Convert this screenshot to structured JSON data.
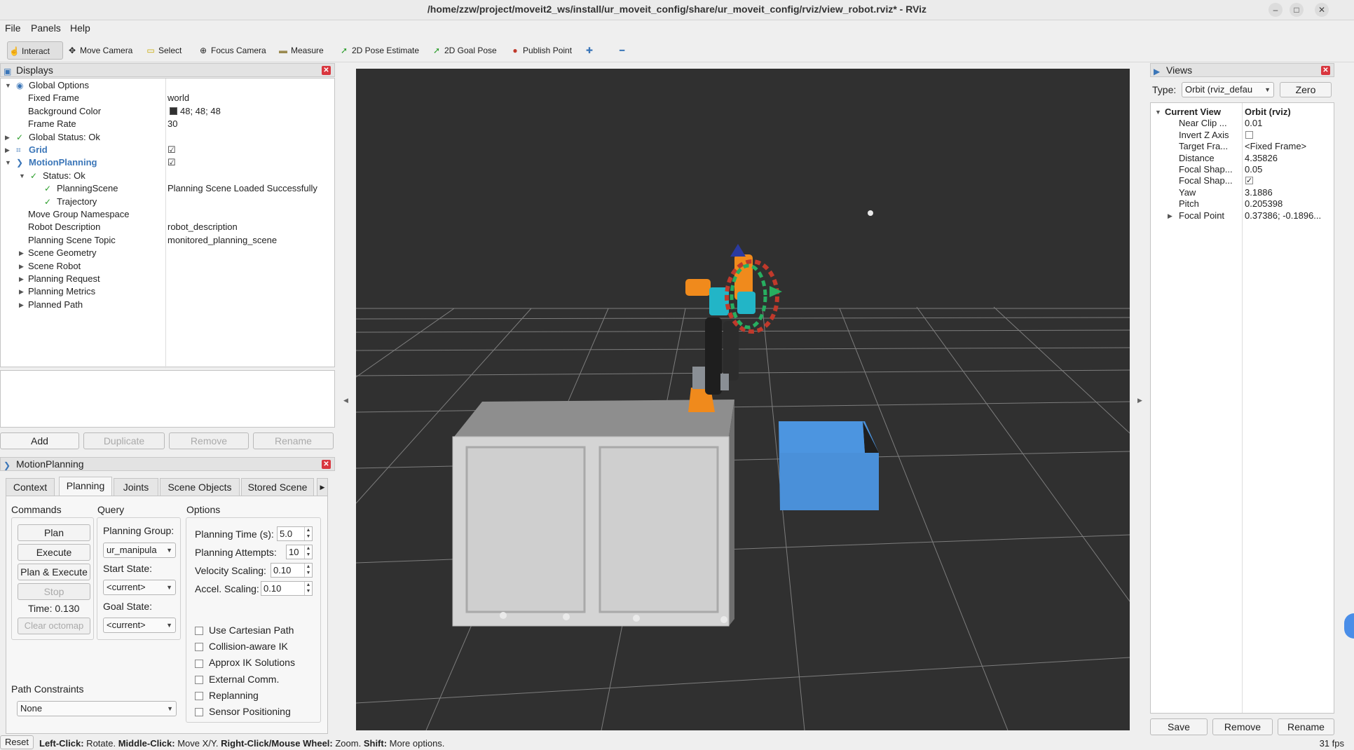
{
  "window": {
    "title": "/home/zzw/project/moveit2_ws/install/ur_moveit_config/share/ur_moveit_config/rviz/view_robot.rviz* - RViz",
    "min": "–",
    "max": "□",
    "close": "✕"
  },
  "menu": [
    "File",
    "Panels",
    "Help"
  ],
  "toolbar": [
    {
      "label": "Interact",
      "icon": "hand-icon",
      "glyph": "☝"
    },
    {
      "label": "Move Camera",
      "icon": "move-camera-icon",
      "glyph": "✥"
    },
    {
      "label": "Select",
      "icon": "select-icon",
      "glyph": "▭"
    },
    {
      "label": "Focus Camera",
      "icon": "focus-camera-icon",
      "glyph": "⊕"
    },
    {
      "label": "Measure",
      "icon": "ruler-icon",
      "glyph": "▬"
    },
    {
      "label": "2D Pose Estimate",
      "icon": "pose-estimate-icon",
      "glyph": "➚"
    },
    {
      "label": "2D Goal Pose",
      "icon": "goal-pose-icon",
      "glyph": "➚"
    },
    {
      "label": "Publish Point",
      "icon": "map-pin-icon",
      "glyph": "📍"
    },
    {
      "label": "",
      "icon": "plus-icon",
      "glyph": "✚"
    },
    {
      "label": "",
      "icon": "minus-icon",
      "glyph": "━"
    }
  ],
  "displays": {
    "title": "Displays",
    "rows": [
      {
        "name": "Global Options",
        "value": "",
        "level": 0,
        "icon": "◉"
      },
      {
        "name": "Fixed Frame",
        "value": "world",
        "level": 1
      },
      {
        "name": "Background Color",
        "value": "48; 48; 48",
        "level": 1
      },
      {
        "name": "Frame Rate",
        "value": "30",
        "level": 1
      },
      {
        "name": "Global Status: Ok",
        "value": "",
        "level": 0,
        "icon": "✓"
      },
      {
        "name": "Grid",
        "value": "☑",
        "level": 0,
        "icon": "⌗"
      },
      {
        "name": "MotionPlanning",
        "value": "☑",
        "level": 0,
        "icon": "❯"
      },
      {
        "name": "Status: Ok",
        "value": "",
        "level": 1,
        "icon": "✓"
      },
      {
        "name": "PlanningScene",
        "value": "Planning Scene Loaded Successfully",
        "level": 2,
        "icon": "✓"
      },
      {
        "name": "Trajectory",
        "value": "",
        "level": 2,
        "icon": "✓"
      },
      {
        "name": "Move Group Namespace",
        "value": "",
        "level": 1
      },
      {
        "name": "Robot Description",
        "value": "robot_description",
        "level": 1
      },
      {
        "name": "Planning Scene Topic",
        "value": "monitored_planning_scene",
        "level": 1
      },
      {
        "name": "Scene Geometry",
        "value": "",
        "level": 1
      },
      {
        "name": "Scene Robot",
        "value": "",
        "level": 1
      },
      {
        "name": "Planning Request",
        "value": "",
        "level": 1
      },
      {
        "name": "Planning Metrics",
        "value": "",
        "level": 1
      },
      {
        "name": "Planned Path",
        "value": "",
        "level": 1
      }
    ],
    "buttons": [
      "Add",
      "Duplicate",
      "Remove",
      "Rename"
    ]
  },
  "motion": {
    "title": "MotionPlanning",
    "tabs": [
      "Context",
      "Planning",
      "Joints",
      "Scene Objects",
      "Stored Scene"
    ],
    "commands_label": "Commands",
    "query_label": "Query",
    "options_label": "Options",
    "plan": "Plan",
    "execute": "Execute",
    "plan_execute": "Plan & Execute",
    "stop": "Stop",
    "time": "Time: 0.130",
    "clear": "Clear octomap",
    "planning_group_label": "Planning Group:",
    "planning_group": "ur_manipula",
    "start_state_label": "Start State:",
    "start_state": "<current>",
    "goal_state_label": "Goal State:",
    "goal_state": "<current>",
    "planning_time_label": "Planning Time (s):",
    "planning_time": "5.0",
    "planning_attempts_label": "Planning Attempts:",
    "planning_attempts": "10",
    "velocity_label": "Velocity Scaling:",
    "velocity": "0.10",
    "accel_label": "Accel. Scaling:",
    "accel": "0.10",
    "checks": [
      "Use Cartesian Path",
      "Collision-aware IK",
      "Approx IK Solutions",
      "External Comm.",
      "Replanning",
      "Sensor Positioning"
    ],
    "path_constraints_label": "Path Constraints",
    "path_constraints": "None"
  },
  "views": {
    "title": "Views",
    "type_label": "Type:",
    "type": "Orbit (rviz_defau",
    "zero": "Zero",
    "rows": [
      {
        "name": "Current View",
        "value": "Orbit (rviz)"
      },
      {
        "name": "Near Clip ...",
        "value": "0.01"
      },
      {
        "name": "Invert Z Axis",
        "value": ""
      },
      {
        "name": "Target Fra...",
        "value": "<Fixed Frame>"
      },
      {
        "name": "Distance",
        "value": "4.35826"
      },
      {
        "name": "Focal Shap...",
        "value": "0.05"
      },
      {
        "name": "Focal Shap...",
        "value": "✓"
      },
      {
        "name": "Yaw",
        "value": "3.1886"
      },
      {
        "name": "Pitch",
        "value": "0.205398"
      },
      {
        "name": "Focal Point",
        "value": "0.37386; -0.1896..."
      }
    ],
    "buttons": [
      "Save",
      "Remove",
      "Rename"
    ]
  },
  "status": {
    "reset": "Reset",
    "text_b1": "Left-Click:",
    "text_1": " Rotate. ",
    "text_b2": "Middle-Click:",
    "text_2": " Move X/Y. ",
    "text_b3": "Right-Click/Mouse Wheel:",
    "text_3": " Zoom. ",
    "text_b4": "Shift:",
    "text_4": " More options.",
    "fps": "31 fps"
  }
}
